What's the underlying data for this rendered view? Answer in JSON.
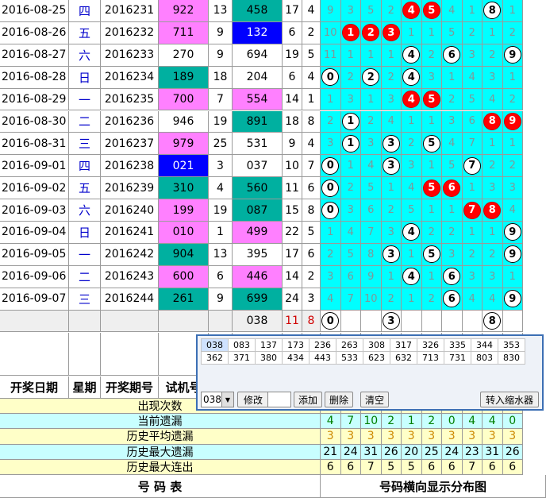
{
  "colors": {
    "pink": "#ff80ff",
    "teal": "#00b0a0",
    "blue": "#0000ff",
    "cyan": "#00ffff",
    "yellowRow": "#ffffc8",
    "cyanRow": "#c8ffff",
    "red": "#ff0000"
  },
  "rows": [
    {
      "date": "2016-08-25",
      "week": "四",
      "period": "2016231",
      "test": "922",
      "test_bg": "pink",
      "sum1": "13",
      "draw": "458",
      "draw_bg": "teal",
      "sum2": "17",
      "span": "4",
      "cells": [
        {
          "t": "9"
        },
        {
          "t": "3"
        },
        {
          "t": "5"
        },
        {
          "t": "2"
        },
        {
          "t": "4",
          "b": "red"
        },
        {
          "t": "5",
          "b": "red"
        },
        {
          "t": "4"
        },
        {
          "t": "1"
        },
        {
          "t": "8",
          "b": "black"
        },
        {
          "t": "1"
        }
      ]
    },
    {
      "date": "2016-08-26",
      "week": "五",
      "period": "2016232",
      "test": "711",
      "test_bg": "pink",
      "sum1": "9",
      "draw": "132",
      "draw_bg": "blue",
      "sum2": "6",
      "span": "2",
      "cells": [
        {
          "t": "10"
        },
        {
          "t": "1",
          "b": "red"
        },
        {
          "t": "2",
          "b": "red"
        },
        {
          "t": "3",
          "b": "red"
        },
        {
          "t": "1"
        },
        {
          "t": "1"
        },
        {
          "t": "5"
        },
        {
          "t": "2"
        },
        {
          "t": "1"
        },
        {
          "t": "2"
        }
      ]
    },
    {
      "date": "2016-08-27",
      "week": "六",
      "period": "2016233",
      "test": "270",
      "test_bg": "",
      "sum1": "9",
      "draw": "694",
      "draw_bg": "",
      "sum2": "19",
      "span": "5",
      "cells": [
        {
          "t": "11"
        },
        {
          "t": "1"
        },
        {
          "t": "1"
        },
        {
          "t": "1"
        },
        {
          "t": "4",
          "b": "black"
        },
        {
          "t": "2"
        },
        {
          "t": "6",
          "b": "black"
        },
        {
          "t": "3"
        },
        {
          "t": "2"
        },
        {
          "t": "9",
          "b": "black"
        }
      ]
    },
    {
      "date": "2016-08-28",
      "week": "日",
      "period": "2016234",
      "test": "189",
      "test_bg": "teal",
      "sum1": "18",
      "draw": "204",
      "draw_bg": "",
      "sum2": "6",
      "span": "4",
      "cells": [
        {
          "t": "0",
          "b": "black"
        },
        {
          "t": "2"
        },
        {
          "t": "2",
          "b": "black"
        },
        {
          "t": "2"
        },
        {
          "t": "4",
          "b": "black"
        },
        {
          "t": "3"
        },
        {
          "t": "1"
        },
        {
          "t": "4"
        },
        {
          "t": "3"
        },
        {
          "t": "1"
        }
      ]
    },
    {
      "date": "2016-08-29",
      "week": "一",
      "period": "2016235",
      "test": "700",
      "test_bg": "pink",
      "sum1": "7",
      "draw": "554",
      "draw_bg": "pink",
      "sum2": "14",
      "span": "1",
      "cells": [
        {
          "t": "1"
        },
        {
          "t": "3"
        },
        {
          "t": "1"
        },
        {
          "t": "3"
        },
        {
          "t": "4",
          "b": "red"
        },
        {
          "t": "5",
          "b": "red"
        },
        {
          "t": "2"
        },
        {
          "t": "5"
        },
        {
          "t": "4"
        },
        {
          "t": "2"
        }
      ]
    },
    {
      "date": "2016-08-30",
      "week": "二",
      "period": "2016236",
      "test": "946",
      "test_bg": "",
      "sum1": "19",
      "draw": "891",
      "draw_bg": "teal",
      "sum2": "18",
      "span": "8",
      "cells": [
        {
          "t": "2"
        },
        {
          "t": "1",
          "b": "black"
        },
        {
          "t": "2"
        },
        {
          "t": "4"
        },
        {
          "t": "1"
        },
        {
          "t": "1"
        },
        {
          "t": "3"
        },
        {
          "t": "6"
        },
        {
          "t": "8",
          "b": "red"
        },
        {
          "t": "9",
          "b": "red"
        }
      ]
    },
    {
      "date": "2016-08-31",
      "week": "三",
      "period": "2016237",
      "test": "979",
      "test_bg": "pink",
      "sum1": "25",
      "draw": "531",
      "draw_bg": "",
      "sum2": "9",
      "span": "4",
      "cells": [
        {
          "t": "3"
        },
        {
          "t": "1",
          "b": "black"
        },
        {
          "t": "3"
        },
        {
          "t": "3",
          "b": "black"
        },
        {
          "t": "2"
        },
        {
          "t": "5",
          "b": "black"
        },
        {
          "t": "4"
        },
        {
          "t": "7"
        },
        {
          "t": "1"
        },
        {
          "t": "1"
        }
      ]
    },
    {
      "date": "2016-09-01",
      "week": "四",
      "period": "2016238",
      "test": "021",
      "test_bg": "blue",
      "sum1": "3",
      "draw": "037",
      "draw_bg": "",
      "sum2": "10",
      "span": "7",
      "cells": [
        {
          "t": "0",
          "b": "black"
        },
        {
          "t": "1"
        },
        {
          "t": "4"
        },
        {
          "t": "3",
          "b": "black"
        },
        {
          "t": "3"
        },
        {
          "t": "1"
        },
        {
          "t": "5"
        },
        {
          "t": "7",
          "b": "black"
        },
        {
          "t": "2"
        },
        {
          "t": "2"
        }
      ]
    },
    {
      "date": "2016-09-02",
      "week": "五",
      "period": "2016239",
      "test": "310",
      "test_bg": "teal",
      "sum1": "4",
      "draw": "560",
      "draw_bg": "teal",
      "sum2": "11",
      "span": "6",
      "cells": [
        {
          "t": "0",
          "b": "black"
        },
        {
          "t": "2"
        },
        {
          "t": "5"
        },
        {
          "t": "1"
        },
        {
          "t": "4"
        },
        {
          "t": "5",
          "b": "red"
        },
        {
          "t": "6",
          "b": "red"
        },
        {
          "t": "1"
        },
        {
          "t": "3"
        },
        {
          "t": "3"
        }
      ]
    },
    {
      "date": "2016-09-03",
      "week": "六",
      "period": "2016240",
      "test": "199",
      "test_bg": "pink",
      "sum1": "19",
      "draw": "087",
      "draw_bg": "teal",
      "sum2": "15",
      "span": "8",
      "cells": [
        {
          "t": "0",
          "b": "black"
        },
        {
          "t": "3"
        },
        {
          "t": "6"
        },
        {
          "t": "2"
        },
        {
          "t": "5"
        },
        {
          "t": "1"
        },
        {
          "t": "1"
        },
        {
          "t": "7",
          "b": "red"
        },
        {
          "t": "8",
          "b": "red"
        },
        {
          "t": "4"
        }
      ]
    },
    {
      "date": "2016-09-04",
      "week": "日",
      "period": "2016241",
      "test": "010",
      "test_bg": "pink",
      "sum1": "1",
      "draw": "499",
      "draw_bg": "pink",
      "sum2": "22",
      "span": "5",
      "cells": [
        {
          "t": "1"
        },
        {
          "t": "4"
        },
        {
          "t": "7"
        },
        {
          "t": "3"
        },
        {
          "t": "4",
          "b": "black"
        },
        {
          "t": "2"
        },
        {
          "t": "2"
        },
        {
          "t": "1"
        },
        {
          "t": "1"
        },
        {
          "t": "9",
          "b": "black"
        }
      ]
    },
    {
      "date": "2016-09-05",
      "week": "一",
      "period": "2016242",
      "test": "904",
      "test_bg": "teal",
      "sum1": "13",
      "draw": "395",
      "draw_bg": "",
      "sum2": "17",
      "span": "6",
      "cells": [
        {
          "t": "2"
        },
        {
          "t": "5"
        },
        {
          "t": "8"
        },
        {
          "t": "3",
          "b": "black"
        },
        {
          "t": "1"
        },
        {
          "t": "5",
          "b": "black"
        },
        {
          "t": "3"
        },
        {
          "t": "2"
        },
        {
          "t": "2"
        },
        {
          "t": "9",
          "b": "black"
        }
      ]
    },
    {
      "date": "2016-09-06",
      "week": "二",
      "period": "2016243",
      "test": "600",
      "test_bg": "pink",
      "sum1": "6",
      "draw": "446",
      "draw_bg": "pink",
      "sum2": "14",
      "span": "2",
      "cells": [
        {
          "t": "3"
        },
        {
          "t": "6"
        },
        {
          "t": "9"
        },
        {
          "t": "1"
        },
        {
          "t": "4",
          "b": "black"
        },
        {
          "t": "1"
        },
        {
          "t": "6",
          "b": "black"
        },
        {
          "t": "3"
        },
        {
          "t": "3"
        },
        {
          "t": "1"
        }
      ]
    },
    {
      "date": "2016-09-07",
      "week": "三",
      "period": "2016244",
      "test": "261",
      "test_bg": "teal",
      "sum1": "9",
      "draw": "699",
      "draw_bg": "teal",
      "sum2": "24",
      "span": "3",
      "cells": [
        {
          "t": "4"
        },
        {
          "t": "7"
        },
        {
          "t": "10"
        },
        {
          "t": "2"
        },
        {
          "t": "1"
        },
        {
          "t": "2"
        },
        {
          "t": "6",
          "b": "black"
        },
        {
          "t": "4"
        },
        {
          "t": "4"
        },
        {
          "t": "9",
          "b": "black"
        }
      ]
    }
  ],
  "predict": {
    "draw": "038",
    "sum2": "11",
    "span": "8",
    "balls": [
      {
        "col": 0,
        "t": "0"
      },
      {
        "col": 3,
        "t": "3"
      },
      {
        "col": 8,
        "t": "8"
      }
    ]
  },
  "header": {
    "date": "开奖日期",
    "week": "星期",
    "period": "开奖期号",
    "test": "试机号"
  },
  "stats": [
    {
      "label": "出现次数",
      "values": [
        "",
        "",
        "",
        "",
        "",
        "",
        "",
        "",
        "",
        ""
      ]
    },
    {
      "label": "当前遗漏",
      "values": [
        "4",
        "7",
        "10",
        "2",
        "1",
        "2",
        "0",
        "4",
        "4",
        "0"
      ]
    },
    {
      "label": "历史平均遗漏",
      "values": [
        "3",
        "3",
        "3",
        "3",
        "3",
        "3",
        "3",
        "3",
        "3",
        "3"
      ]
    },
    {
      "label": "历史最大遗漏",
      "values": [
        "21",
        "24",
        "31",
        "26",
        "20",
        "25",
        "24",
        "23",
        "31",
        "26"
      ]
    },
    {
      "label": "历史最大连出",
      "values": [
        "6",
        "6",
        "7",
        "5",
        "5",
        "6",
        "6",
        "7",
        "6",
        "6"
      ]
    }
  ],
  "footer": {
    "left": "号 码 表",
    "right": "号码横向显示分布图"
  },
  "dialog": {
    "row1": [
      "038",
      "083",
      "137",
      "173",
      "236",
      "263",
      "308",
      "317",
      "326",
      "335",
      "344",
      "353"
    ],
    "row2": [
      "362",
      "371",
      "380",
      "434",
      "443",
      "533",
      "623",
      "632",
      "713",
      "731",
      "803",
      "830"
    ],
    "select_value": "038",
    "btn_modify": "修改",
    "btn_add": "添加",
    "btn_delete": "删除",
    "btn_clear": "清空",
    "btn_transfer": "转入缩水器"
  }
}
